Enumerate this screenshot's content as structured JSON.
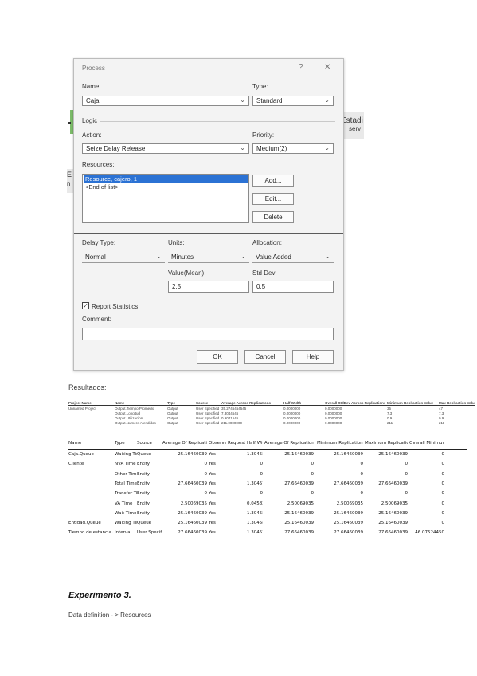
{
  "bg": {
    "right_text_1": "Estadi",
    "right_text_2": "serv",
    "left_text_1": "E",
    "left_text_2": "n"
  },
  "dialog": {
    "title": "Process",
    "help_glyph": "?",
    "close_glyph": "✕",
    "name_label": "Name:",
    "name_value": "Caja",
    "type_label": "Type:",
    "type_value": "Standard",
    "logic_label": "Logic",
    "action_label": "Action:",
    "action_value": "Seize Delay Release",
    "priority_label": "Priority:",
    "priority_value": "Medium(2)",
    "resources_label": "Resources:",
    "resources": [
      "Resource, cajero, 1",
      "<End of list>"
    ],
    "add_label": "Add...",
    "edit_label": "Edit...",
    "delete_label": "Delete",
    "delay_type_label": "Delay Type:",
    "delay_type_value": "Normal",
    "units_label": "Units:",
    "units_value": "Minutes",
    "allocation_label": "Allocation:",
    "allocation_value": "Value Added",
    "mean_label": "Value(Mean):",
    "mean_value": "2.5",
    "stddev_label": "Std Dev:",
    "stddev_value": "0.5",
    "report_stats_label": "Report Statistics",
    "report_stats_checked": "✓",
    "comment_label": "Comment:",
    "comment_value": "",
    "ok_label": "OK",
    "cancel_label": "Cancel",
    "help_label": "Help"
  },
  "results": {
    "heading": "Resultados:",
    "summary_headers": [
      "Project Name",
      "Name",
      "Type",
      "Source",
      "Average Across Replications",
      "Half Width",
      "Overall StdDev Across Replications",
      "Minimum Replication Value",
      "Max Replication Value"
    ],
    "summary_rows": [
      [
        "Unnamed Project",
        "Output.Tiempo.Promedio",
        "Output",
        "User Specified",
        "35.2745454545",
        "0.0000000",
        "0.0000000",
        "35",
        "47"
      ],
      [
        "",
        "Output.Longitud",
        "Output",
        "User Specified",
        "7.3044545",
        "0.0000000",
        "0.0000000",
        "7.3",
        "7.3"
      ],
      [
        "",
        "Output.Utilizacion",
        "Output",
        "User Specified",
        "0.9041545",
        "0.0000000",
        "0.0000000",
        "0.9",
        "0.9"
      ],
      [
        "",
        "Output.Numero Atendidos",
        "Output",
        "User Specified",
        "211.0000000",
        "0.0000000",
        "0.0000000",
        "211",
        "211"
      ]
    ],
    "detail_headers": [
      "Name",
      "Type",
      "Source",
      "Average Of Replication Averages",
      "Observed",
      "Requested",
      "Half Width",
      "Average Of Replication Averages",
      "Minimum Replication Average",
      "Maximum Replication Average",
      "Overall Minimum Value"
    ],
    "detail_rows": [
      [
        "Caja.Queue",
        "Waiting Time",
        "Queue",
        "25.16460039",
        "Yes",
        "",
        "1.30458100",
        "25.16460039",
        "25.16460039",
        "25.16460039",
        "0"
      ],
      [
        "Cliente",
        "NVA Time",
        "Entity",
        "0",
        "Yes",
        "",
        "0",
        "0",
        "0",
        "0",
        "0"
      ],
      [
        "",
        "Other Time",
        "Entity",
        "0",
        "Yes",
        "",
        "0",
        "0",
        "0",
        "0",
        "0"
      ],
      [
        "",
        "Total Time",
        "Entity",
        "27.66460039",
        "Yes",
        "",
        "1.30457100",
        "27.66460039",
        "27.66460039",
        "27.66460039",
        "0"
      ],
      [
        "",
        "Transfer Time",
        "Entity",
        "0",
        "Yes",
        "",
        "0",
        "0",
        "0",
        "0",
        "0"
      ],
      [
        "",
        "VA Time",
        "Entity",
        "2.50069035",
        "Yes",
        "",
        "0.04582029",
        "2.50069035",
        "2.50069035",
        "2.50069035",
        "0"
      ],
      [
        "",
        "Wait Time",
        "Entity",
        "25.16460039",
        "Yes",
        "",
        "1.30458100",
        "25.16460039",
        "25.16460039",
        "25.16460039",
        "0"
      ],
      [
        "Entidad.Queue",
        "Waiting Time",
        "Queue",
        "25.16460039",
        "Yes",
        "",
        "1.30458100",
        "25.16460039",
        "25.16460039",
        "25.16460039",
        "0"
      ],
      [
        "Tiempo de estancia en el sistema",
        "Interval",
        "User Specified",
        "27.66460039",
        "Yes",
        "",
        "1.30457100",
        "27.66460039",
        "27.66460039",
        "27.66460039",
        "46.07524450"
      ]
    ]
  },
  "experiment": {
    "heading": "Experimento 3.",
    "subtitle": "Data definition - > Resources"
  }
}
